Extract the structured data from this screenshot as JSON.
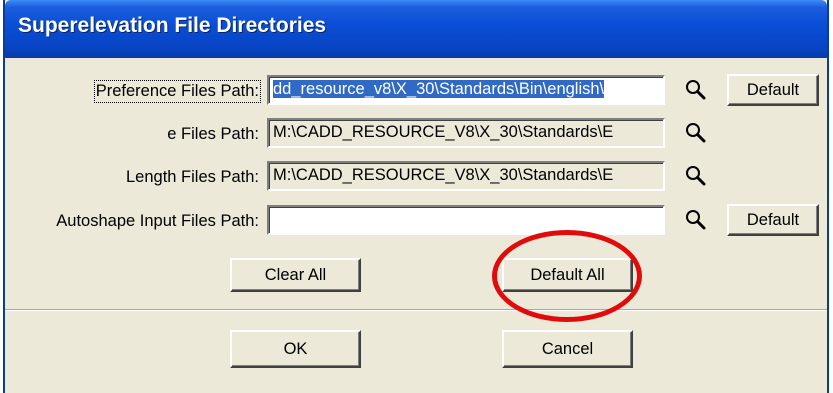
{
  "window": {
    "title": "Superelevation File Directories"
  },
  "rows": [
    {
      "label": "Preference Files Path:",
      "value_selected": "dd_resource_v8\\X_30\\Standards\\Bin\\english\\",
      "has_default": true,
      "default_label": "Default"
    },
    {
      "label": "e Files Path:",
      "value": "M:\\CADD_RESOURCE_V8\\X_30\\Standards\\E",
      "has_default": false
    },
    {
      "label": "Length Files Path:",
      "value": "M:\\CADD_RESOURCE_V8\\X_30\\Standards\\E",
      "has_default": false
    },
    {
      "label": "Autoshape Input Files Path:",
      "value": "",
      "has_default": true,
      "default_label": "Default"
    }
  ],
  "buttons": {
    "clear_all": "Clear All",
    "default_all": "Default All",
    "ok": "OK",
    "cancel": "Cancel"
  },
  "icons": {
    "browse": "magnifier-icon"
  },
  "colors": {
    "titlebar": "#0a4fd6",
    "dialog_bg": "#ece9d8",
    "selection": "#316ac5",
    "annotation_circle": "#e10b0b"
  }
}
